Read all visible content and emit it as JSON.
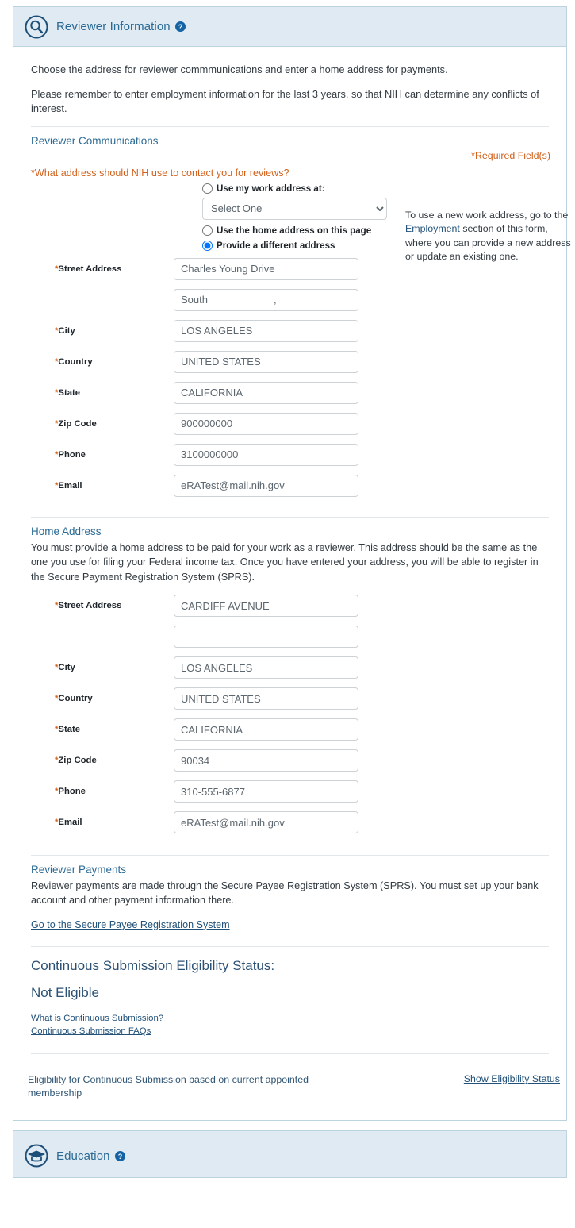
{
  "header": {
    "title": "Reviewer Information",
    "icon": "magnifier-circle-icon",
    "help_icon": "help-question-icon"
  },
  "intro": {
    "line1": "Choose the address for reviewer commmunications and enter a home address for payments.",
    "line2": "Please remember to enter employment information for the last 3 years, so that NIH can determine any conflicts of interest."
  },
  "communications": {
    "heading": "Reviewer Communications",
    "required_note": "*Required Field(s)",
    "question": "*What address should NIH use to contact you for reviews?",
    "radios": [
      {
        "label": "Use my work address at:",
        "checked": false
      },
      {
        "label": "Use the home address on this page",
        "checked": false
      },
      {
        "label": "Provide a different address",
        "checked": true
      }
    ],
    "work_address_select": {
      "selected": "Select One",
      "options": [
        "Select One"
      ]
    },
    "side_note": {
      "before": "To use a new work address, go to the ",
      "link": "Employment",
      "after": " section of this form, where you can provide a new address or update an existing one."
    },
    "fields": [
      {
        "label": "Street Address",
        "required": true,
        "value": "Charles Young Drive"
      },
      {
        "label": "",
        "required": false,
        "value": "South                       ,"
      },
      {
        "label": "City",
        "required": true,
        "value": "LOS ANGELES"
      },
      {
        "label": "Country",
        "required": true,
        "value": "UNITED STATES"
      },
      {
        "label": "State",
        "required": true,
        "value": "CALIFORNIA"
      },
      {
        "label": "Zip Code",
        "required": true,
        "value": "900000000"
      },
      {
        "label": "Phone",
        "required": true,
        "value": "3100000000"
      },
      {
        "label": "Email",
        "required": true,
        "value": "eRATest@mail.nih.gov"
      }
    ]
  },
  "home_address": {
    "heading": "Home Address",
    "description": "You must provide a home address to be paid for your work as a reviewer. This address should be the same as the one you use for filing your Federal income tax. Once you have entered your address, you will be able to register in the Secure Payment Registration System (SPRS).",
    "fields": [
      {
        "label": "Street Address",
        "required": true,
        "value": "CARDIFF AVENUE"
      },
      {
        "label": "",
        "required": false,
        "value": ""
      },
      {
        "label": "City",
        "required": true,
        "value": "LOS ANGELES"
      },
      {
        "label": "Country",
        "required": true,
        "value": "UNITED STATES"
      },
      {
        "label": "State",
        "required": true,
        "value": "CALIFORNIA"
      },
      {
        "label": "Zip Code",
        "required": true,
        "value": "90034"
      },
      {
        "label": "Phone",
        "required": true,
        "value": "310-555-6877"
      },
      {
        "label": "Email",
        "required": true,
        "value": "eRATest@mail.nih.gov"
      }
    ]
  },
  "payments": {
    "heading": "Reviewer Payments",
    "description": "Reviewer payments are made through the Secure Payee Registration System (SPRS). You must set up your bank account and other payment information there.",
    "link": "Go to the Secure Payee Registration System"
  },
  "continuous_submission": {
    "title": "Continuous Submission Eligibility Status:",
    "status": "Not Eligible",
    "links": [
      "What is Continuous Submission?",
      "Continuous Submission FAQs"
    ],
    "eligibility_text": "Eligibility for Continuous Submission based on current appointed membership",
    "show_status_link": "Show Eligibility Status"
  },
  "footer_section": {
    "title": "Education",
    "icon": "graduation-cap-circle-icon",
    "help_icon": "help-question-icon"
  },
  "colors": {
    "header_band": "#dfeaf2",
    "panel_border": "#bcd3e0",
    "section_heading": "#2b6a94",
    "required_orange": "#d2601a",
    "link_navy": "#22527a",
    "status_navy": "#2b5174"
  }
}
